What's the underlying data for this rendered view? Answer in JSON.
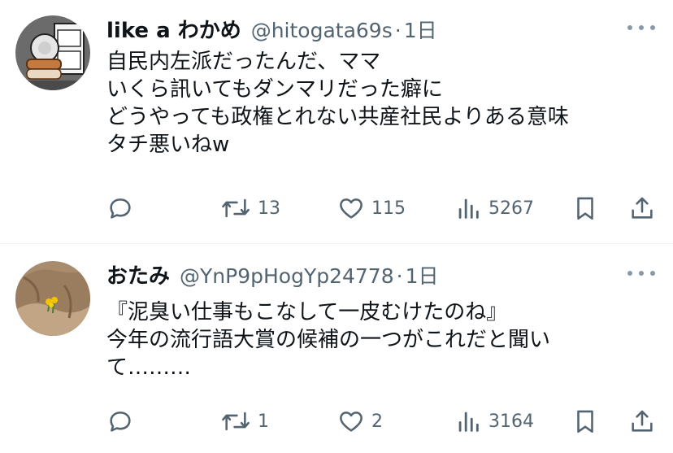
{
  "tweets": [
    {
      "name": "like a わかめ",
      "handle": "@hitogata69s",
      "sep": "·",
      "time": "1日",
      "lines": [
        "自民内左派だったんだ、ママ",
        "いくら訊いてもダンマリだった癖に",
        "どうやっても政権とれない共産社民よりある意味",
        "タチ悪いねw"
      ],
      "actions": {
        "reply": "",
        "retweets": "13",
        "likes": "115",
        "views": "5267"
      },
      "avatar_icon": "fridge-character-avatar"
    },
    {
      "name": "おたみ",
      "handle": "@YnP9pHogYp24778",
      "sep": "·",
      "time": "1日",
      "lines": [
        "『泥臭い仕事もこなして一皮むけたのね』",
        "今年の流行語大賞の候補の一つがこれだと聞い",
        "て………"
      ],
      "actions": {
        "reply": "",
        "retweets": "1",
        "likes": "2",
        "views": "3164"
      },
      "avatar_icon": "rock-flower-avatar"
    }
  ],
  "colors": {
    "text": "#0f1419",
    "secondary": "#536471",
    "divider": "#eff3f4"
  },
  "icons": [
    "reply-icon",
    "retweet-icon",
    "like-icon",
    "views-icon",
    "bookmark-icon",
    "share-icon",
    "more-icon"
  ]
}
